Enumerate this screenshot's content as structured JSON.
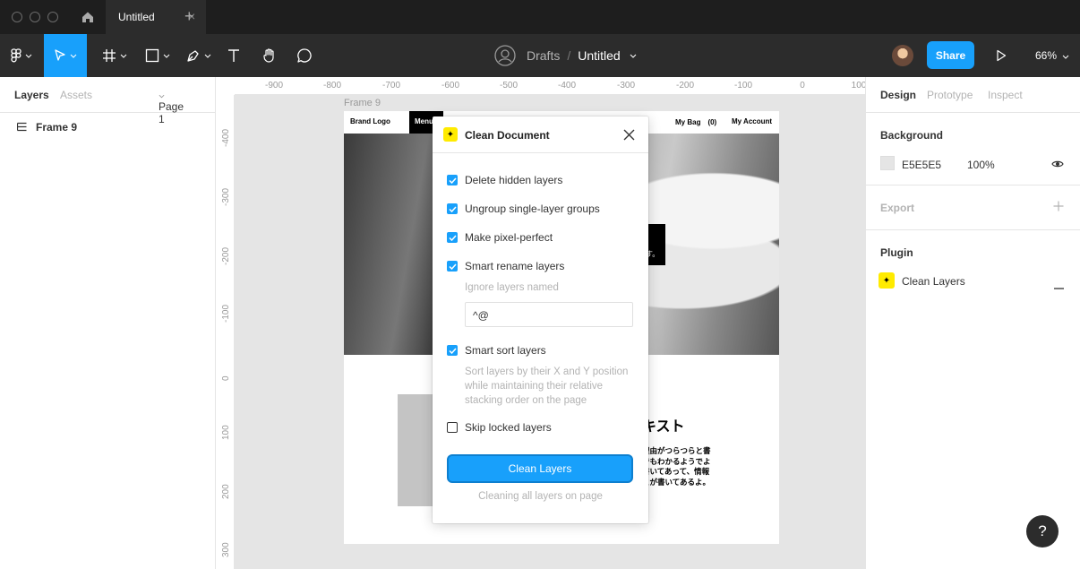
{
  "window": {
    "tab_title": "Untitled",
    "tab_close": "×",
    "tab_add": "+"
  },
  "toolbar": {
    "breadcrumb_drafts": "Drafts",
    "breadcrumb_sep": "/",
    "file_title": "Untitled",
    "share_label": "Share",
    "zoom_label": "66%"
  },
  "left_panel": {
    "tabs": [
      "Layers",
      "Assets"
    ],
    "page_selector": "Page 1",
    "layers": [
      {
        "label": "Frame 9"
      }
    ]
  },
  "canvas": {
    "ruler_top_labels": [
      "-900",
      "-800",
      "-700",
      "-600",
      "-500",
      "-400",
      "-300",
      "-200",
      "-100",
      "0",
      "100"
    ],
    "ruler_left_labels": [
      "-400",
      "-300",
      "-200",
      "-100",
      "0",
      "100",
      "200",
      "300"
    ],
    "frame_label": "Frame 9",
    "frame": {
      "nav_brand": "Brand Logo",
      "nav_menu": "Menu",
      "nav_bag": "My Bag　(0)",
      "nav_account": "My Account",
      "hero_fragment": "す。",
      "jp_title": "キスト",
      "jp_body_lines": [
        "理由がつらつらと書",
        "でもわかるようでよ",
        "書いてあって、情報",
        "とが書いてあるよ。"
      ]
    }
  },
  "plugin_dialog": {
    "title": "Clean Document",
    "badge_glyph": "✦",
    "options": [
      {
        "label": "Delete hidden layers",
        "checked": true
      },
      {
        "label": "Ungroup single-layer groups",
        "checked": true
      },
      {
        "label": "Make pixel-perfect",
        "checked": true
      },
      {
        "label": "Smart rename layers",
        "checked": true
      },
      {
        "label": "Smart sort layers",
        "checked": true
      },
      {
        "label": "Skip locked layers",
        "checked": false
      }
    ],
    "ignore_label": "Ignore layers named",
    "ignore_value": "^@",
    "sort_hint": "Sort layers by their X and Y position while maintaining their relative stacking order on the page",
    "button_label": "Clean Layers",
    "status": "Cleaning all layers on page"
  },
  "right_panel": {
    "tabs": [
      "Design",
      "Prototype",
      "Inspect"
    ],
    "background_title": "Background",
    "background_hex": "E5E5E5",
    "background_opacity": "100%",
    "export_title": "Export",
    "plugin_title": "Plugin",
    "plugin_name": "Clean Layers",
    "plugin_badge_glyph": "✦"
  },
  "help_glyph": "?",
  "colors": {
    "accent": "#18a0fb",
    "plugin_yellow": "#ffeb00",
    "toolbar_bg": "#2c2c2c",
    "canvas_bg": "#e5e5e5"
  },
  "icons": [
    "figma-menu-icon",
    "move-tool-icon",
    "frame-tool-icon",
    "shape-tool-icon",
    "pen-tool-icon",
    "text-tool-icon",
    "hand-tool-icon",
    "comment-tool-icon",
    "team-avatar-icon",
    "play-icon",
    "home-icon",
    "close-icon",
    "eye-icon",
    "plus-icon",
    "minus-icon",
    "help-icon"
  ]
}
